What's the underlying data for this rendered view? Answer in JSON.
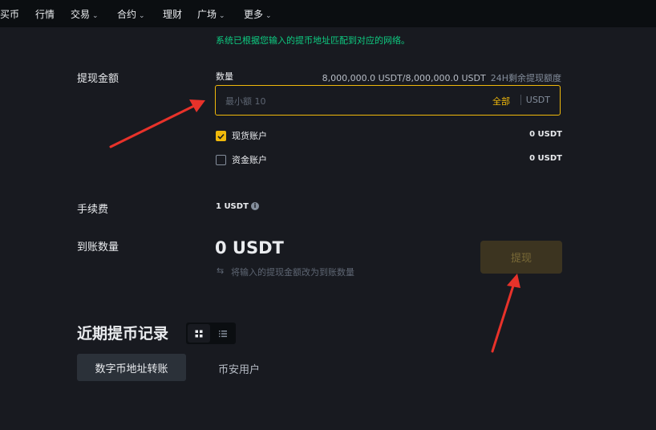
{
  "nav": {
    "items": [
      {
        "label": "买币",
        "dropdown": false
      },
      {
        "label": "行情",
        "dropdown": false
      },
      {
        "label": "交易",
        "dropdown": true
      },
      {
        "label": "合约",
        "dropdown": true
      },
      {
        "label": "理财",
        "dropdown": false
      },
      {
        "label": "广场",
        "dropdown": true
      },
      {
        "label": "更多",
        "dropdown": true
      }
    ]
  },
  "notice": "系统已根据您输入的提币地址匹配到对应的网络。",
  "withdraw": {
    "label": "提现金额",
    "quantity_label": "数量",
    "limit_value": "8,000,000.0 USDT/8,000,000.0 USDT",
    "limit_text": "24H剩余提现额度",
    "amount_value": "",
    "amount_placeholder": "最小额 10",
    "all_label": "全部",
    "unit": "USDT",
    "accounts": [
      {
        "label": "现货账户",
        "checked": true,
        "value": "0 USDT"
      },
      {
        "label": "资金账户",
        "checked": false,
        "value": "0 USDT"
      }
    ]
  },
  "fee": {
    "label": "手续费",
    "value": "1 USDT",
    "info_icon": "i"
  },
  "receive": {
    "label": "到账数量",
    "value": "0 USDT",
    "swap_icon": "⇆",
    "hint": "将输入的提现金额改为到账数量",
    "button_label": "提现"
  },
  "history": {
    "title": "近期提币记录",
    "tabs": [
      "数字币地址转账",
      "币安用户"
    ]
  },
  "colors": {
    "background": "#181a20",
    "nav_background": "#0b0e11",
    "accent": "#f0b90b",
    "success_text": "#0ecb81",
    "annotation_arrow": "#e8322a"
  }
}
